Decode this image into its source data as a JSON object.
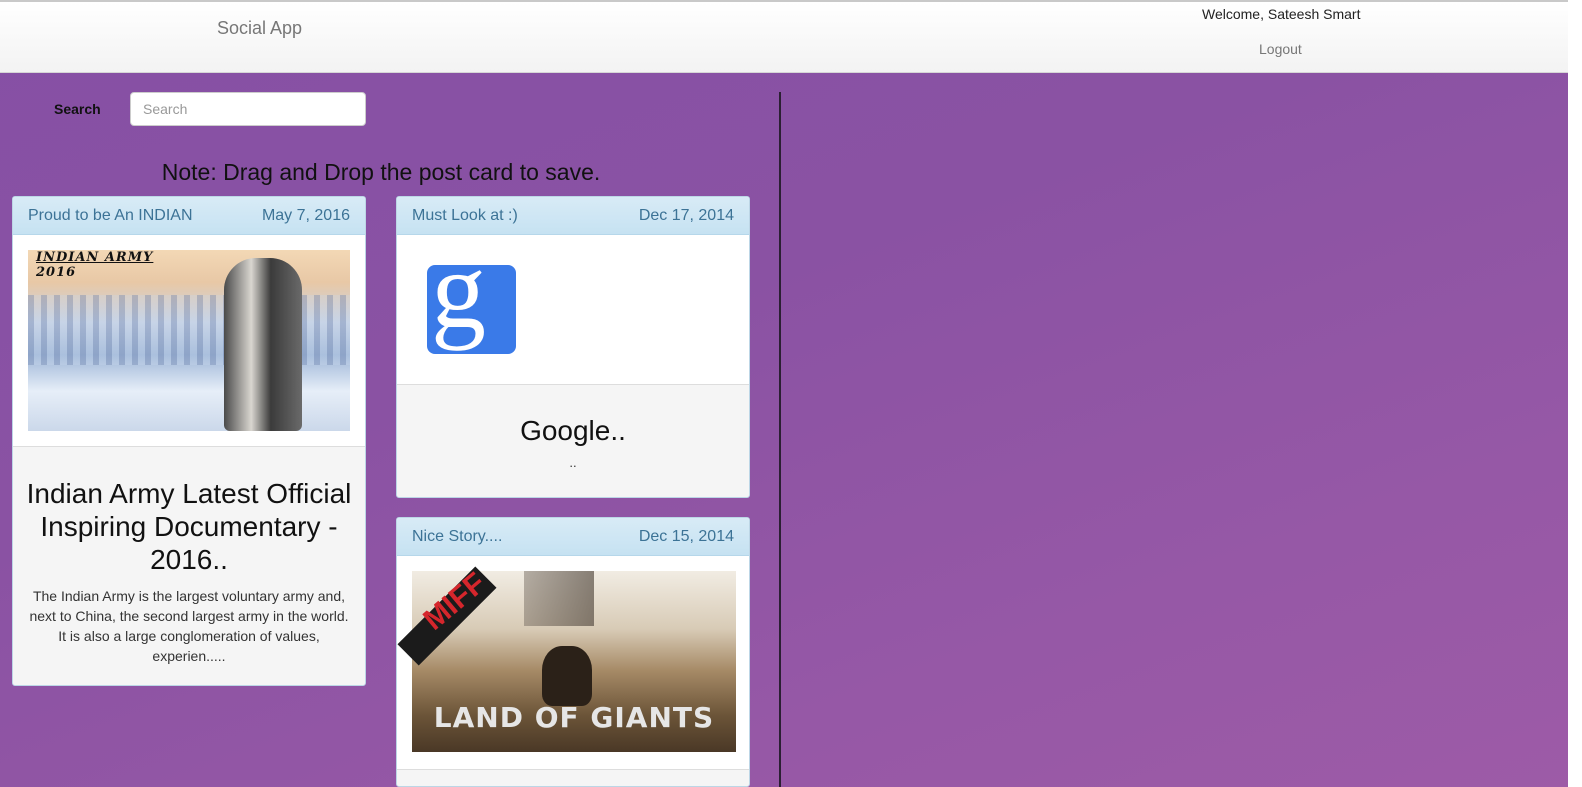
{
  "header": {
    "brand": "Social App",
    "welcome": "Welcome, Sateesh Smart",
    "logout": "Logout"
  },
  "search": {
    "label": "Search",
    "placeholder": "Search",
    "value": ""
  },
  "note": "Note: Drag and Drop the post card to save.",
  "posts": [
    {
      "category": "Proud to be An INDIAN",
      "date": "May 7, 2016",
      "image_caption_line1": "INDIAN ARMY",
      "image_caption_line2": "2016",
      "title": "Indian Army Latest Official Inspiring Documentary - 2016..",
      "description": "The Indian Army is the largest voluntary army and, next to China, the second largest army in the world. It is also a large conglomeration of values, experien....."
    },
    {
      "category": "Must Look at :)",
      "date": "Dec 17, 2014",
      "logo_letter": "g",
      "title": "Google..",
      "description": ".."
    },
    {
      "category": "Nice Story....",
      "date": "Dec 15, 2014",
      "image_badge": "MIFF",
      "image_text": "LAND OF GIANTS"
    }
  ],
  "colors": {
    "background": "#8a52a3",
    "card_header": "#c6e2f2",
    "card_header_text": "#3c7396",
    "google_blue": "#3a7ae8"
  }
}
